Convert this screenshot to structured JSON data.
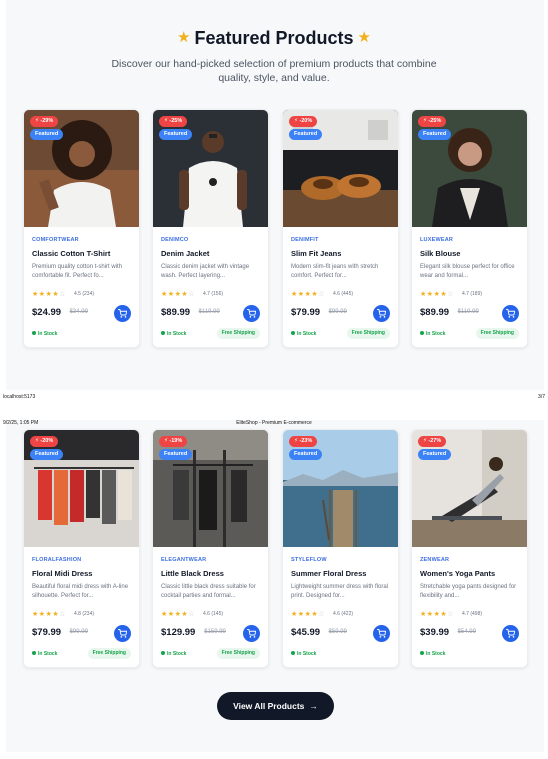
{
  "header": {
    "title": "Featured Products",
    "subtitle": "Discover our hand-picked selection of premium products that combine quality, style, and value."
  },
  "print": {
    "url": "localhost:5173",
    "page": "3/7",
    "date": "9/2/25, 1:05 PM",
    "doc_title": "EliteShop - Premium E-commerce"
  },
  "products": [
    {
      "discount": "-29%",
      "featured": "Featured",
      "brand": "COMFORTWEAR",
      "name": "Classic Cotton T-Shirt",
      "desc": "Premium quality cotton t-shirt with comfortable fit. Perfect fo...",
      "rating": 4.5,
      "rating_text": "4.5 (234)",
      "price": "$24.99",
      "old_price": "$34.99",
      "stock": "In Stock",
      "shipping": ""
    },
    {
      "discount": "-25%",
      "featured": "Featured",
      "brand": "DENIMCO",
      "name": "Denim Jacket",
      "desc": "Classic denim jacket with vintage wash. Perfect layering...",
      "rating": 4.7,
      "rating_text": "4.7 (156)",
      "price": "$89.99",
      "old_price": "$119.99",
      "stock": "In Stock",
      "shipping": "Free Shipping"
    },
    {
      "discount": "-20%",
      "featured": "Featured",
      "brand": "DENIMFIT",
      "name": "Slim Fit Jeans",
      "desc": "Modern slim-fit jeans with stretch comfort. Perfect for...",
      "rating": 4.6,
      "rating_text": "4.6 (445)",
      "price": "$79.99",
      "old_price": "$99.99",
      "stock": "In Stock",
      "shipping": "Free Shipping"
    },
    {
      "discount": "-25%",
      "featured": "Featured",
      "brand": "LUXEWEAR",
      "name": "Silk Blouse",
      "desc": "Elegant silk blouse perfect for office wear and formal...",
      "rating": 4.7,
      "rating_text": "4.7 (189)",
      "price": "$89.99",
      "old_price": "$119.99",
      "stock": "In Stock",
      "shipping": "Free Shipping"
    },
    {
      "discount": "-20%",
      "featured": "Featured",
      "brand": "FLORALFASHION",
      "name": "Floral Midi Dress",
      "desc": "Beautiful floral midi dress with A-line silhouette. Perfect for...",
      "rating": 4.8,
      "rating_text": "4.8 (234)",
      "price": "$79.99",
      "old_price": "$99.99",
      "stock": "In Stock",
      "shipping": "Free Shipping"
    },
    {
      "discount": "-19%",
      "featured": "Featured",
      "brand": "ELEGANTWEAR",
      "name": "Little Black Dress",
      "desc": "Classic little black dress suitable for cocktail parties and formal...",
      "rating": 4.6,
      "rating_text": "4.6 (145)",
      "price": "$129.99",
      "old_price": "$159.99",
      "stock": "In Stock",
      "shipping": "Free Shipping"
    },
    {
      "discount": "-23%",
      "featured": "Featured",
      "brand": "STYLEFLOW",
      "name": "Summer Floral Dress",
      "desc": "Lightweight summer dress with floral print. Designed for...",
      "rating": 4.6,
      "rating_text": "4.6 (422)",
      "price": "$45.99",
      "old_price": "$59.99",
      "stock": "In Stock",
      "shipping": ""
    },
    {
      "discount": "-27%",
      "featured": "Featured",
      "brand": "ZENWEAR",
      "name": "Women's Yoga Pants",
      "desc": "Stretchable yoga pants designed for flexibility and...",
      "rating": 4.7,
      "rating_text": "4.7 (498)",
      "price": "$39.99",
      "old_price": "$54.99",
      "stock": "In Stock",
      "shipping": ""
    }
  ],
  "view_all_label": "View All Products",
  "colors": {
    "accent": "#2563eb",
    "discount": "#ef4444",
    "featured": "#3b82f6",
    "star": "#f2b01e",
    "in_stock": "#16a34a",
    "dark_button": "#111827"
  }
}
